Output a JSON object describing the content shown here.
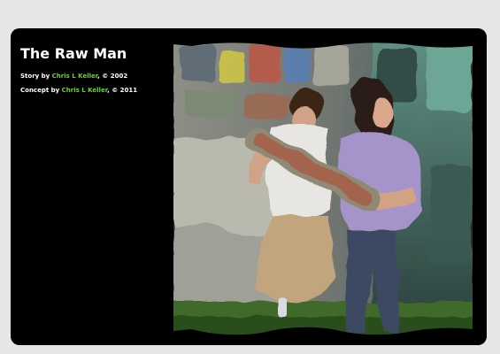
{
  "page": {
    "title": "The Raw Man",
    "credits": {
      "story_prefix": "Story by",
      "story_author": "Chris L Keller",
      "story_suffix": ", © 2002",
      "concept_prefix": "Concept by",
      "concept_author": "Chris L Keller",
      "concept_suffix": ", © 2011"
    }
  },
  "colors": {
    "page_bg": "#e6e6e6",
    "card_bg": "#000000",
    "title_text": "#ffffff",
    "link": "#6fcf2f"
  },
  "illustration": {
    "subject": "two people standing by a graffiti wall, one holding a skateboard"
  }
}
